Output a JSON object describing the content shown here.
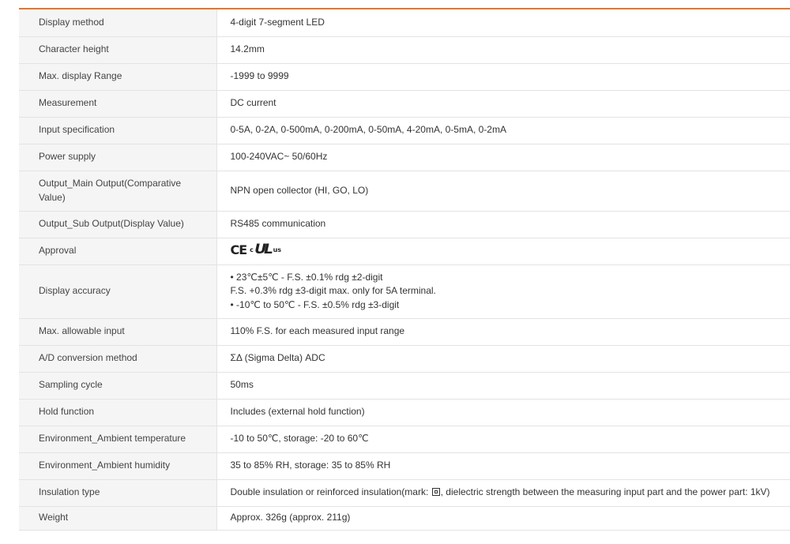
{
  "specs": [
    {
      "label": "Display method",
      "value": "4-digit 7-segment LED"
    },
    {
      "label": "Character height",
      "value": "14.2mm"
    },
    {
      "label": "Max. display Range",
      "value": "-1999 to 9999"
    },
    {
      "label": "Measurement",
      "value": "DC current"
    },
    {
      "label": "Input specification",
      "value": "0-5A, 0-2A, 0-500mA, 0-200mA, 0-50mA, 4-20mA, 0-5mA, 0-2mA"
    },
    {
      "label": "Power supply",
      "value": "100-240VAC~ 50/60Hz"
    },
    {
      "label": "Output_Main Output(Comparative Value)",
      "value": "NPN open collector (HI, GO, LO)"
    },
    {
      "label": "Output_Sub Output(Display Value)",
      "value": "RS485 communication"
    },
    {
      "label": "Approval",
      "cert": {
        "ce": "CE",
        "c": "c",
        "ul": "UL",
        "us": "us"
      }
    },
    {
      "label": "Display accuracy",
      "lines": [
        "• 23℃±5℃ - F.S. ±0.1% rdg ±2-digit",
        "F.S. +0.3% rdg ±3-digit max. only for 5A terminal.",
        "• -10℃ to 50℃ - F.S. ±0.5% rdg ±3-digit"
      ]
    },
    {
      "label": "Max. allowable input",
      "value": "110% F.S. for each measured input range"
    },
    {
      "label": "A/D conversion method",
      "value": "ΣΔ (Sigma Delta) ADC"
    },
    {
      "label": "Sampling cycle",
      "value": "50ms"
    },
    {
      "label": "Hold function",
      "value": "Includes (external hold function)"
    },
    {
      "label": "Environment_Ambient temperature",
      "value": "-10 to 50℃, storage: -20 to 60℃"
    },
    {
      "label": "Environment_Ambient humidity",
      "value": "35 to 85% RH, storage: 35 to 85% RH"
    },
    {
      "label": "Insulation type",
      "value_pre": "Double insulation or reinforced insulation(mark: ",
      "value_post": ", dielectric strength between the measuring input part and the power part: 1kV)"
    },
    {
      "label": "Weight",
      "value": "Approx. 326g (approx. 211g)"
    }
  ],
  "colors": {
    "accent_rule": "#e8742b",
    "label_bg": "#f5f5f5",
    "border": "#e3e3e3"
  },
  "icons": {
    "insulation_mark": "double-insulation-icon"
  }
}
